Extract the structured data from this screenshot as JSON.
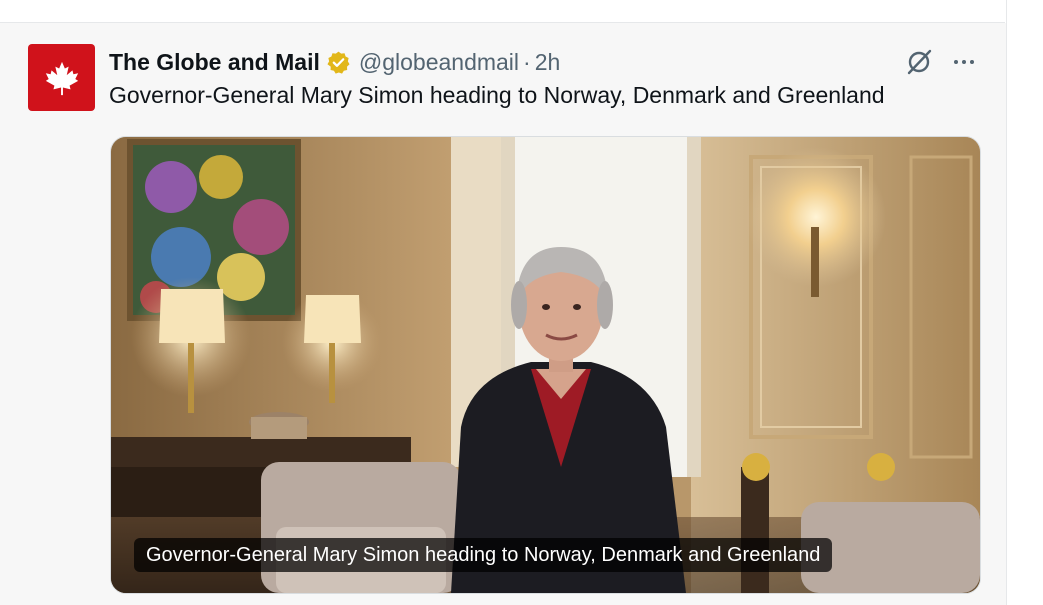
{
  "post": {
    "author_name": "The Globe and Mail",
    "handle": "@globeandmail",
    "separator": "·",
    "time": "2h",
    "text": "Governor-General Mary Simon heading to Norway, Denmark and Greenland",
    "media_caption": "Governor-General Mary Simon heading to Norway, Denmark and Greenland",
    "avatar_icon": "maple-leaf-icon",
    "verified_icon": "verified-badge-icon",
    "colors": {
      "avatar_bg": "#d0121b",
      "verified_badge": "#e2b719"
    }
  }
}
